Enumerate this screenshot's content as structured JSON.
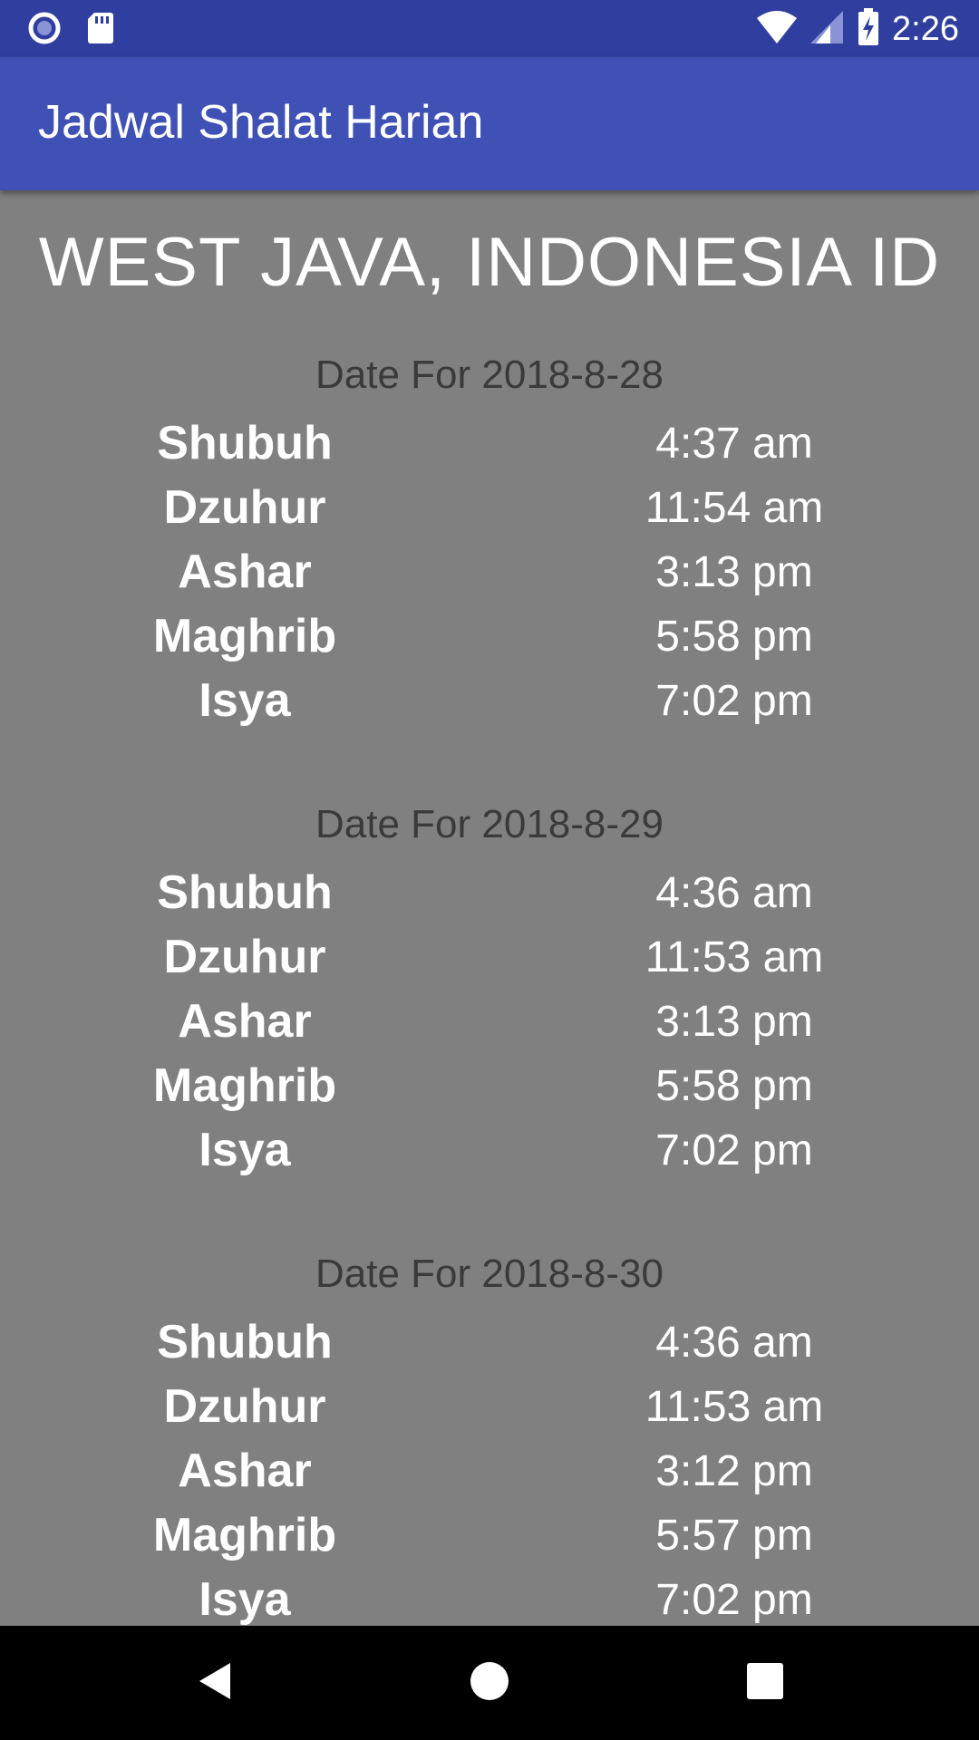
{
  "status_bar": {
    "time": "2:26",
    "icons": [
      "circle-notification-icon",
      "sd-card-icon",
      "wifi-icon",
      "signal-icon",
      "battery-charging-icon"
    ]
  },
  "app_bar": {
    "title": "Jadwal Shalat Harian"
  },
  "location": "WEST JAVA, INDONESIA ID",
  "days": [
    {
      "date_label": "Date For 2018-8-28",
      "prayers": [
        {
          "name": "Shubuh",
          "time": "4:37 am"
        },
        {
          "name": "Dzuhur",
          "time": "11:54 am"
        },
        {
          "name": "Ashar",
          "time": "3:13 pm"
        },
        {
          "name": "Maghrib",
          "time": "5:58 pm"
        },
        {
          "name": "Isya",
          "time": "7:02 pm"
        }
      ]
    },
    {
      "date_label": "Date For 2018-8-29",
      "prayers": [
        {
          "name": "Shubuh",
          "time": "4:36 am"
        },
        {
          "name": "Dzuhur",
          "time": "11:53 am"
        },
        {
          "name": "Ashar",
          "time": "3:13 pm"
        },
        {
          "name": "Maghrib",
          "time": "5:58 pm"
        },
        {
          "name": "Isya",
          "time": "7:02 pm"
        }
      ]
    },
    {
      "date_label": "Date For 2018-8-30",
      "prayers": [
        {
          "name": "Shubuh",
          "time": "4:36 am"
        },
        {
          "name": "Dzuhur",
          "time": "11:53 am"
        },
        {
          "name": "Ashar",
          "time": "3:12 pm"
        },
        {
          "name": "Maghrib",
          "time": "5:57 pm"
        },
        {
          "name": "Isya",
          "time": "7:02 pm"
        }
      ]
    }
  ],
  "nav_bar": {
    "icons": [
      "back-icon",
      "home-icon",
      "recents-icon"
    ]
  },
  "colors": {
    "status_bar": "#303F9F",
    "app_bar": "#3F51B5",
    "content_bg": "#808080",
    "date_label": "#3a3a3a"
  }
}
